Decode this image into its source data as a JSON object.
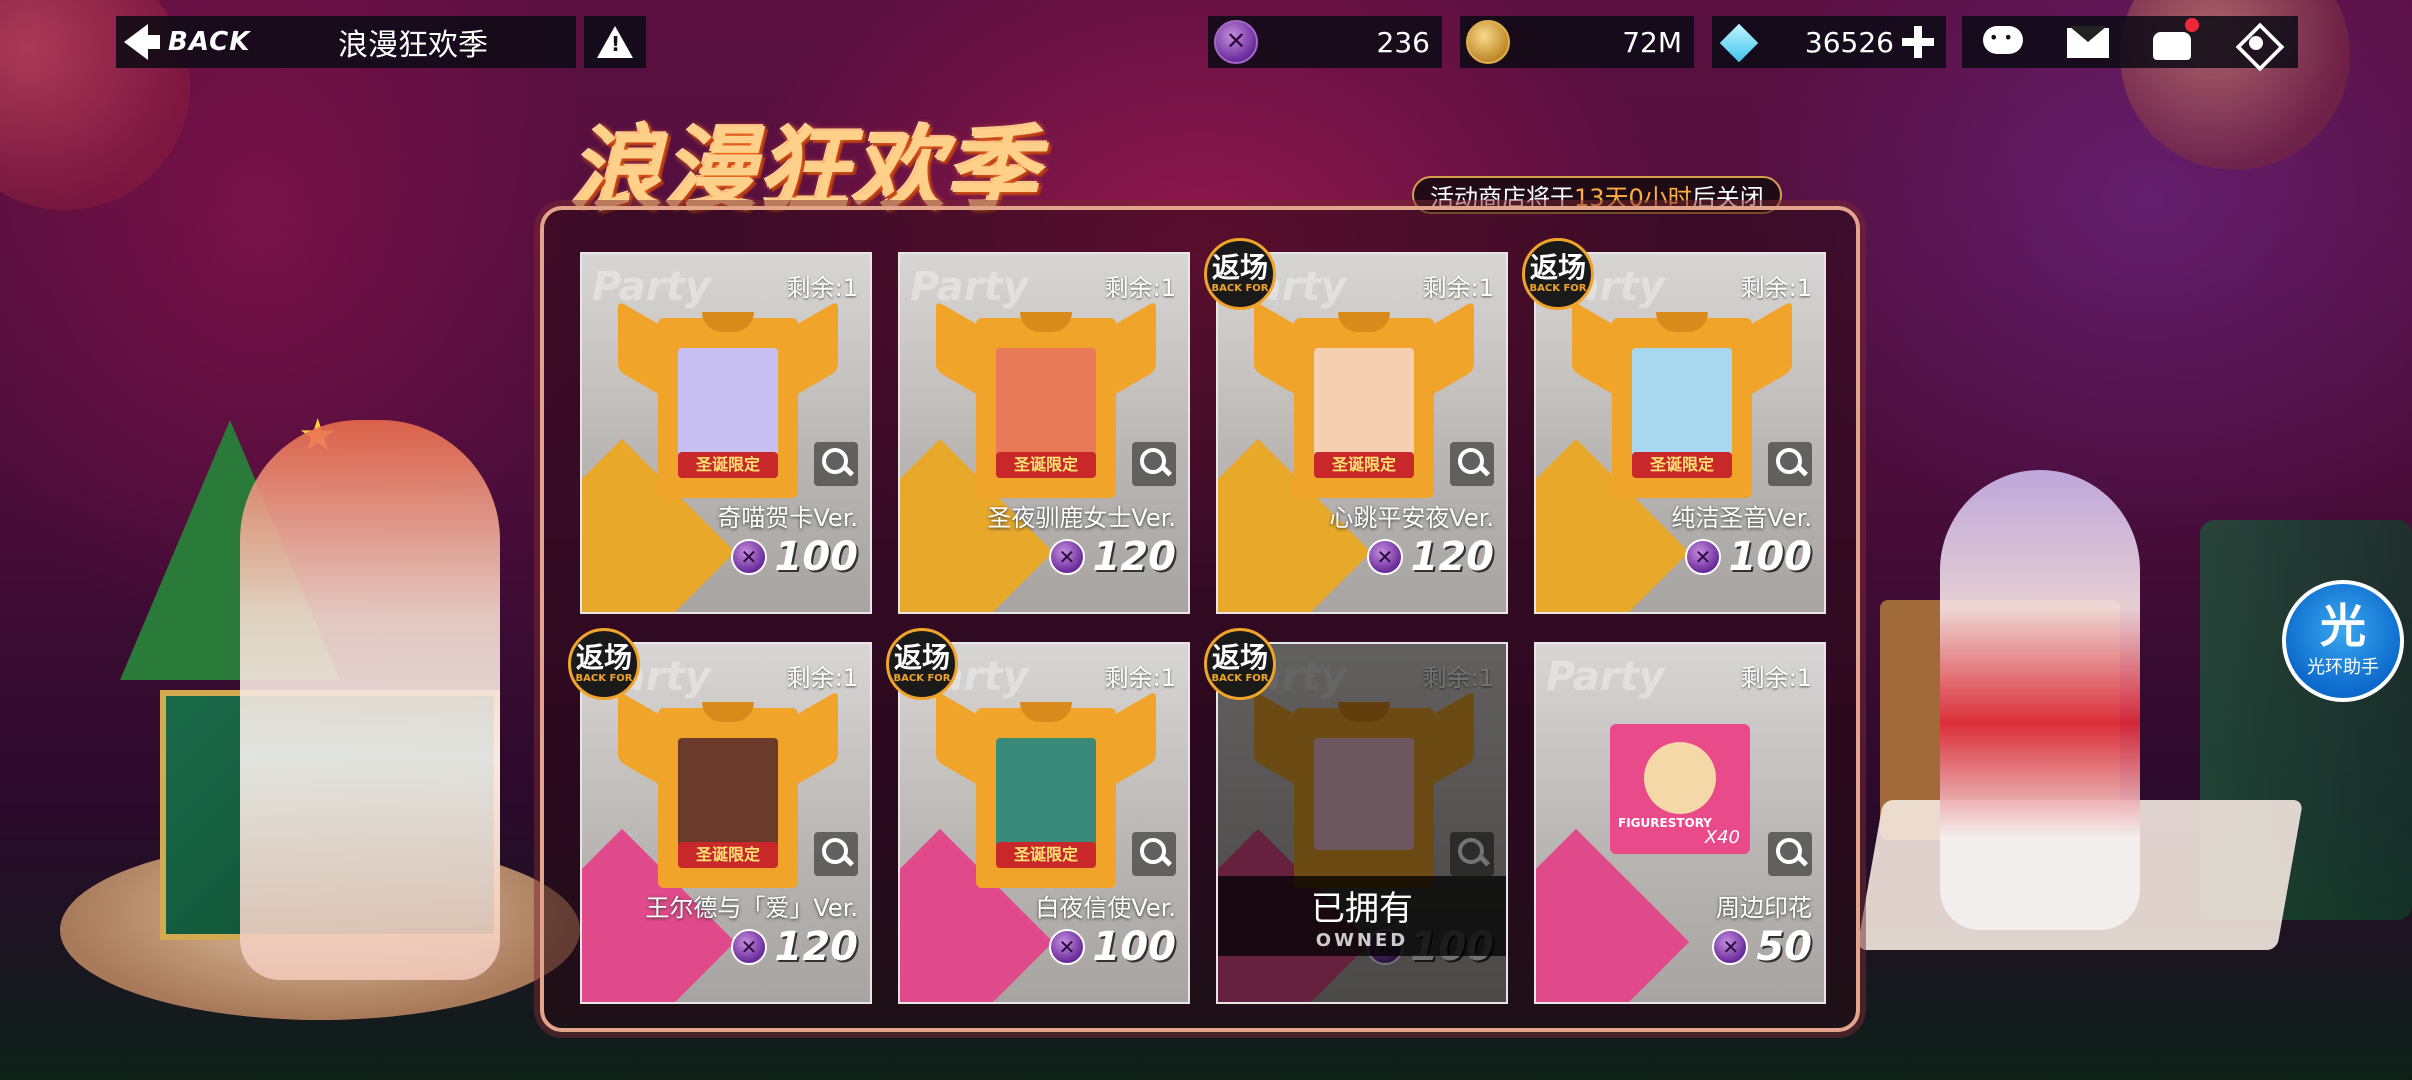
{
  "topbar": {
    "back_label": "BACK",
    "title": "浪漫狂欢季",
    "info_icon": "warning-triangle-icon"
  },
  "currencies": {
    "token": {
      "value": "236",
      "icon": "purple-token-icon"
    },
    "gold": {
      "value": "72M",
      "icon": "gold-coin-icon"
    },
    "diamond": {
      "value": "36526",
      "icon": "diamond-icon"
    }
  },
  "tray_icons": [
    "chat-icon",
    "mail-icon",
    "gift-icon",
    "home-icon"
  ],
  "event": {
    "title": "浪漫狂欢季",
    "notice_prefix": "活动商店将于",
    "notice_highlight": "13天0小时",
    "notice_suffix": "后关闭"
  },
  "items": [
    {
      "remain": "剩余:1",
      "name": "奇喵贺卡Ver.",
      "price": "100",
      "tag": "圣诞限定",
      "return": false,
      "owned": false,
      "portrait_color": "#c8c0f0",
      "stripe": "yellow"
    },
    {
      "remain": "剩余:1",
      "name": "圣夜驯鹿女士Ver.",
      "price": "120",
      "tag": "圣诞限定",
      "return": false,
      "owned": false,
      "portrait_color": "#e87a5a",
      "stripe": "yellow"
    },
    {
      "remain": "剩余:1",
      "name": "心跳平安夜Ver.",
      "price": "120",
      "tag": "圣诞限定",
      "return": true,
      "owned": false,
      "portrait_color": "#f4d0b0",
      "stripe": "yellow"
    },
    {
      "remain": "剩余:1",
      "name": "纯洁圣音Ver.",
      "price": "100",
      "tag": "圣诞限定",
      "return": true,
      "owned": false,
      "portrait_color": "#a8d8f0",
      "stripe": "yellow"
    },
    {
      "remain": "剩余:1",
      "name": "王尔德与「爱」Ver.",
      "price": "120",
      "tag": "圣诞限定",
      "return": true,
      "owned": false,
      "portrait_color": "#6a3a2a",
      "stripe": "pink"
    },
    {
      "remain": "剩余:1",
      "name": "白夜信使Ver.",
      "price": "100",
      "tag": "圣诞限定",
      "return": true,
      "owned": false,
      "portrait_color": "#3a8a7a",
      "stripe": "pink"
    },
    {
      "remain": "剩余:1",
      "name": "",
      "price": "100",
      "tag": "",
      "return": true,
      "owned": true,
      "owned_text": "已拥有",
      "owned_en": "OWNED",
      "portrait_color": "#f0c0d0",
      "stripe": "pink"
    },
    {
      "remain": "剩余:1",
      "name": "周边印花",
      "price": "50",
      "tag": "",
      "return": false,
      "owned": false,
      "figure": {
        "label": "FIGURESTORY",
        "count": "X40"
      },
      "stripe": "pink"
    }
  ],
  "return_badge": {
    "main": "返场",
    "sub": "BACK FOR"
  },
  "assistant": {
    "char": "光",
    "label": "光环助手"
  },
  "colors": {
    "accent": "#f0a42a",
    "token": "#8a4ac0",
    "owned_overlay": "#000000"
  }
}
